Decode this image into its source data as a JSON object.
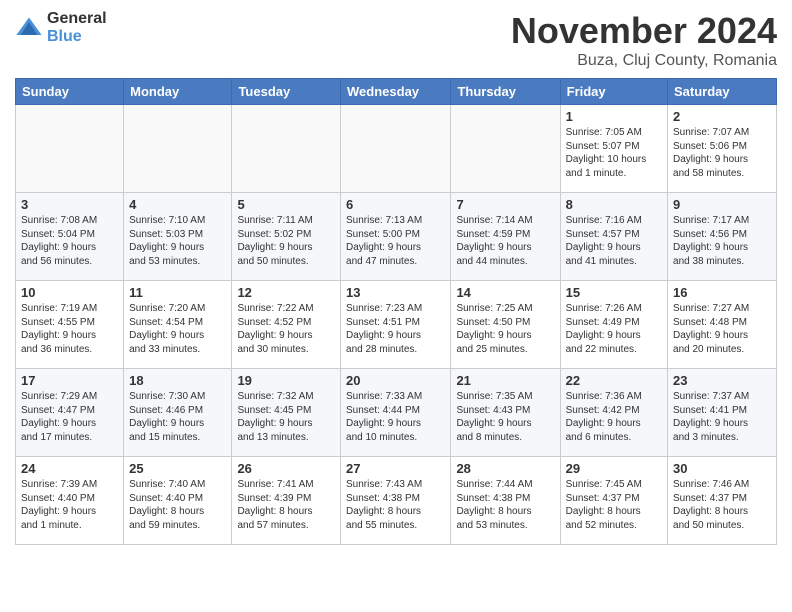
{
  "header": {
    "logo_general": "General",
    "logo_blue": "Blue",
    "month_title": "November 2024",
    "location": "Buza, Cluj County, Romania"
  },
  "weekdays": [
    "Sunday",
    "Monday",
    "Tuesday",
    "Wednesday",
    "Thursday",
    "Friday",
    "Saturday"
  ],
  "weeks": [
    [
      {
        "day": "",
        "info": ""
      },
      {
        "day": "",
        "info": ""
      },
      {
        "day": "",
        "info": ""
      },
      {
        "day": "",
        "info": ""
      },
      {
        "day": "",
        "info": ""
      },
      {
        "day": "1",
        "info": "Sunrise: 7:05 AM\nSunset: 5:07 PM\nDaylight: 10 hours\nand 1 minute."
      },
      {
        "day": "2",
        "info": "Sunrise: 7:07 AM\nSunset: 5:06 PM\nDaylight: 9 hours\nand 58 minutes."
      }
    ],
    [
      {
        "day": "3",
        "info": "Sunrise: 7:08 AM\nSunset: 5:04 PM\nDaylight: 9 hours\nand 56 minutes."
      },
      {
        "day": "4",
        "info": "Sunrise: 7:10 AM\nSunset: 5:03 PM\nDaylight: 9 hours\nand 53 minutes."
      },
      {
        "day": "5",
        "info": "Sunrise: 7:11 AM\nSunset: 5:02 PM\nDaylight: 9 hours\nand 50 minutes."
      },
      {
        "day": "6",
        "info": "Sunrise: 7:13 AM\nSunset: 5:00 PM\nDaylight: 9 hours\nand 47 minutes."
      },
      {
        "day": "7",
        "info": "Sunrise: 7:14 AM\nSunset: 4:59 PM\nDaylight: 9 hours\nand 44 minutes."
      },
      {
        "day": "8",
        "info": "Sunrise: 7:16 AM\nSunset: 4:57 PM\nDaylight: 9 hours\nand 41 minutes."
      },
      {
        "day": "9",
        "info": "Sunrise: 7:17 AM\nSunset: 4:56 PM\nDaylight: 9 hours\nand 38 minutes."
      }
    ],
    [
      {
        "day": "10",
        "info": "Sunrise: 7:19 AM\nSunset: 4:55 PM\nDaylight: 9 hours\nand 36 minutes."
      },
      {
        "day": "11",
        "info": "Sunrise: 7:20 AM\nSunset: 4:54 PM\nDaylight: 9 hours\nand 33 minutes."
      },
      {
        "day": "12",
        "info": "Sunrise: 7:22 AM\nSunset: 4:52 PM\nDaylight: 9 hours\nand 30 minutes."
      },
      {
        "day": "13",
        "info": "Sunrise: 7:23 AM\nSunset: 4:51 PM\nDaylight: 9 hours\nand 28 minutes."
      },
      {
        "day": "14",
        "info": "Sunrise: 7:25 AM\nSunset: 4:50 PM\nDaylight: 9 hours\nand 25 minutes."
      },
      {
        "day": "15",
        "info": "Sunrise: 7:26 AM\nSunset: 4:49 PM\nDaylight: 9 hours\nand 22 minutes."
      },
      {
        "day": "16",
        "info": "Sunrise: 7:27 AM\nSunset: 4:48 PM\nDaylight: 9 hours\nand 20 minutes."
      }
    ],
    [
      {
        "day": "17",
        "info": "Sunrise: 7:29 AM\nSunset: 4:47 PM\nDaylight: 9 hours\nand 17 minutes."
      },
      {
        "day": "18",
        "info": "Sunrise: 7:30 AM\nSunset: 4:46 PM\nDaylight: 9 hours\nand 15 minutes."
      },
      {
        "day": "19",
        "info": "Sunrise: 7:32 AM\nSunset: 4:45 PM\nDaylight: 9 hours\nand 13 minutes."
      },
      {
        "day": "20",
        "info": "Sunrise: 7:33 AM\nSunset: 4:44 PM\nDaylight: 9 hours\nand 10 minutes."
      },
      {
        "day": "21",
        "info": "Sunrise: 7:35 AM\nSunset: 4:43 PM\nDaylight: 9 hours\nand 8 minutes."
      },
      {
        "day": "22",
        "info": "Sunrise: 7:36 AM\nSunset: 4:42 PM\nDaylight: 9 hours\nand 6 minutes."
      },
      {
        "day": "23",
        "info": "Sunrise: 7:37 AM\nSunset: 4:41 PM\nDaylight: 9 hours\nand 3 minutes."
      }
    ],
    [
      {
        "day": "24",
        "info": "Sunrise: 7:39 AM\nSunset: 4:40 PM\nDaylight: 9 hours\nand 1 minute."
      },
      {
        "day": "25",
        "info": "Sunrise: 7:40 AM\nSunset: 4:40 PM\nDaylight: 8 hours\nand 59 minutes."
      },
      {
        "day": "26",
        "info": "Sunrise: 7:41 AM\nSunset: 4:39 PM\nDaylight: 8 hours\nand 57 minutes."
      },
      {
        "day": "27",
        "info": "Sunrise: 7:43 AM\nSunset: 4:38 PM\nDaylight: 8 hours\nand 55 minutes."
      },
      {
        "day": "28",
        "info": "Sunrise: 7:44 AM\nSunset: 4:38 PM\nDaylight: 8 hours\nand 53 minutes."
      },
      {
        "day": "29",
        "info": "Sunrise: 7:45 AM\nSunset: 4:37 PM\nDaylight: 8 hours\nand 52 minutes."
      },
      {
        "day": "30",
        "info": "Sunrise: 7:46 AM\nSunset: 4:37 PM\nDaylight: 8 hours\nand 50 minutes."
      }
    ]
  ]
}
